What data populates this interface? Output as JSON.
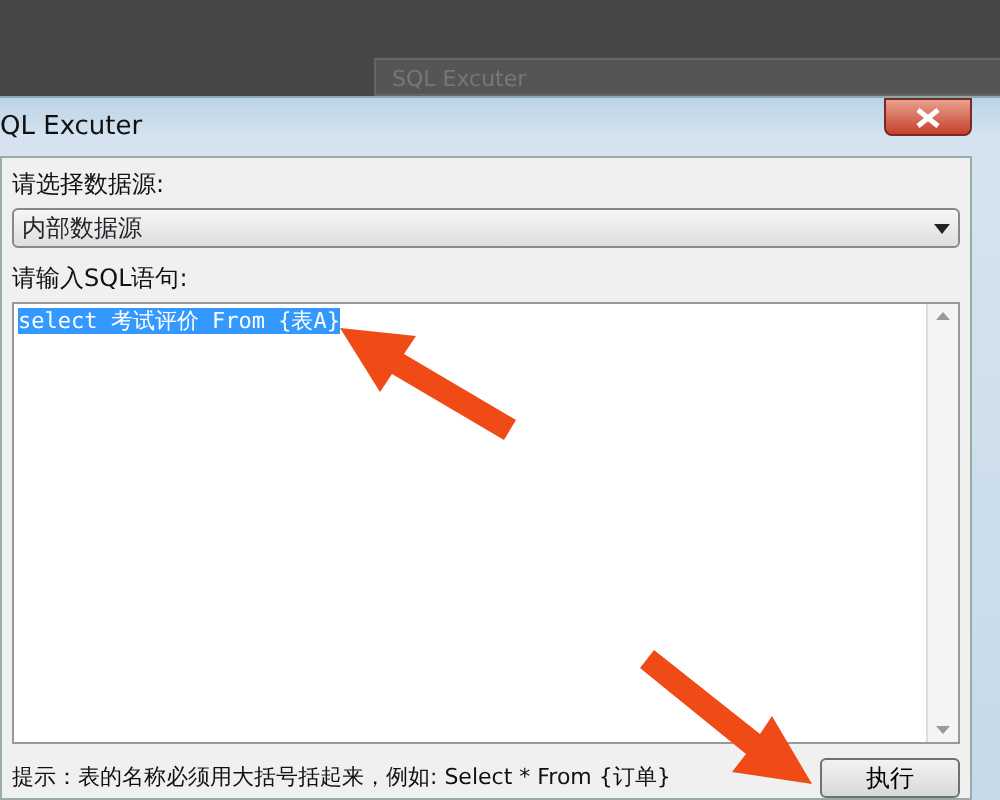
{
  "background_window": {
    "title": "SQL Excuter"
  },
  "window": {
    "title": "QL Excuter"
  },
  "datasource": {
    "label": "请选择数据源:",
    "value": "内部数据源"
  },
  "sql": {
    "label": "请输入SQL语句:",
    "value": "select 考试评价 From {表A}",
    "selected": true
  },
  "hint": "提示：表的名称必须用大括号括起来，例如: Select * From {订单}",
  "buttons": [
    "执行"
  ]
}
